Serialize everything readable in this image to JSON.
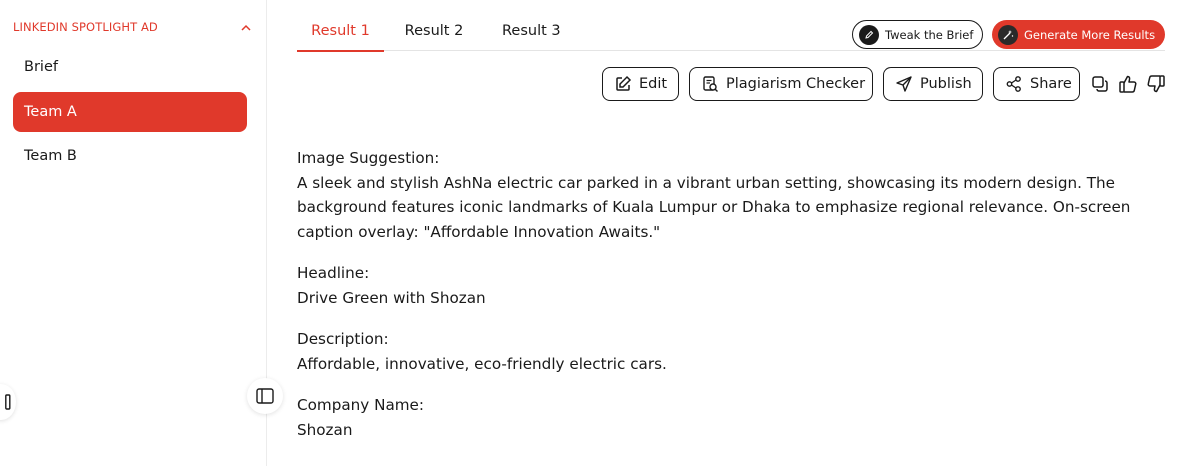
{
  "sidebar": {
    "title": "LINKEDIN SPOTLIGHT AD",
    "items": [
      {
        "label": "Brief"
      },
      {
        "label": "Team A"
      },
      {
        "label": "Team B"
      }
    ]
  },
  "tabs": [
    "Result 1",
    "Result 2",
    "Result 3"
  ],
  "header_buttons": {
    "tweak": "Tweak the Brief",
    "generate": "Generate More Results"
  },
  "actions": {
    "edit": "Edit",
    "plagiarism": "Plagiarism Checker",
    "publish": "Publish",
    "share": "Share"
  },
  "content": {
    "image_suggestion_label": "Image Suggestion:",
    "image_suggestion_text": "A sleek and stylish AshNa electric car parked in a vibrant urban setting, showcasing its modern design. The background features iconic landmarks of Kuala Lumpur or Dhaka to emphasize regional relevance. On-screen caption overlay: \"Affordable Innovation Awaits.\"",
    "headline_label": "Headline:",
    "headline_text": "Drive Green with Shozan",
    "description_label": "Description:",
    "description_text": "Affordable, innovative, eco-friendly electric cars.",
    "company_label": "Company Name:",
    "company_text": "Shozan"
  },
  "colors": {
    "accent": "#e0392b",
    "text": "#1a1a1a"
  }
}
